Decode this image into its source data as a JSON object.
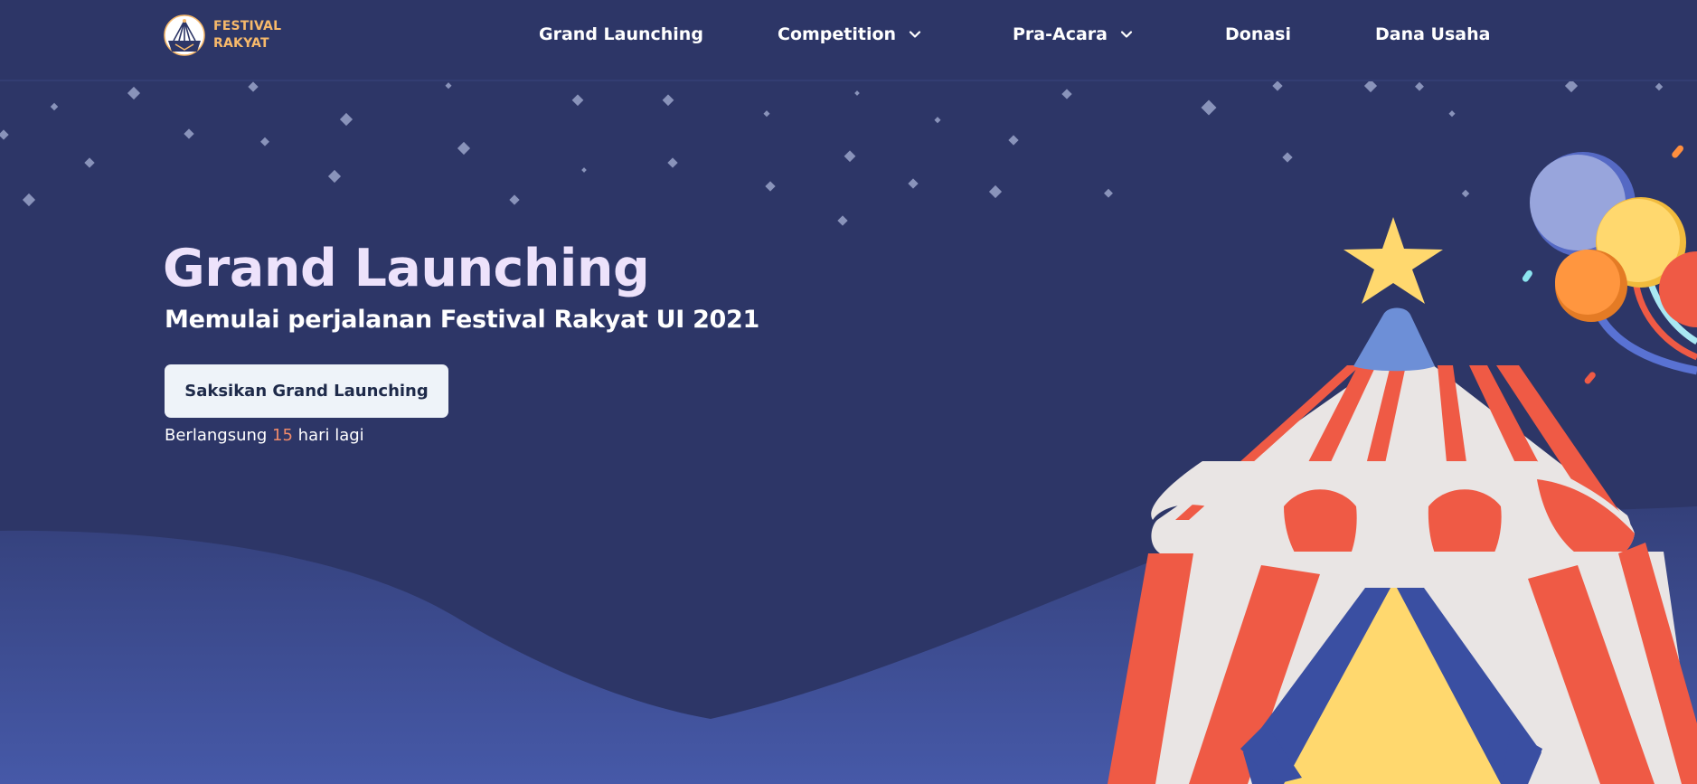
{
  "brand": {
    "line1": "FESTIVAL",
    "line2": "RAKYAT"
  },
  "nav": {
    "items": [
      {
        "label": "Grand Launching",
        "has_dropdown": false
      },
      {
        "label": "Competition",
        "has_dropdown": true
      },
      {
        "label": "Pra-Acara",
        "has_dropdown": true
      },
      {
        "label": "Donasi",
        "has_dropdown": false
      },
      {
        "label": "Dana Usaha",
        "has_dropdown": false
      }
    ]
  },
  "hero": {
    "title": "Grand Launching",
    "subtitle": "Memulai perjalanan Festival Rakyat UI 2021",
    "cta_label": "Saksikan Grand Launching",
    "countdown": {
      "prefix": "Berlangsung ",
      "days": "15",
      "suffix": " hari lagi"
    }
  },
  "colors": {
    "background": "#2d3667",
    "hill": "#3d4e94",
    "title": "#ede2fb",
    "brand": "#f7b96a",
    "tent_red": "#ef5a45",
    "tent_white": "#e9e5e4",
    "tent_yellow": "#ffd86e",
    "tent_blue_top": "#6d8fd7",
    "star": "#ffd86e",
    "countdown_highlight": "#f08a6a"
  },
  "icons": {
    "logo": "festival-rakyat-logo",
    "dropdown": "chevron-down-icon"
  }
}
